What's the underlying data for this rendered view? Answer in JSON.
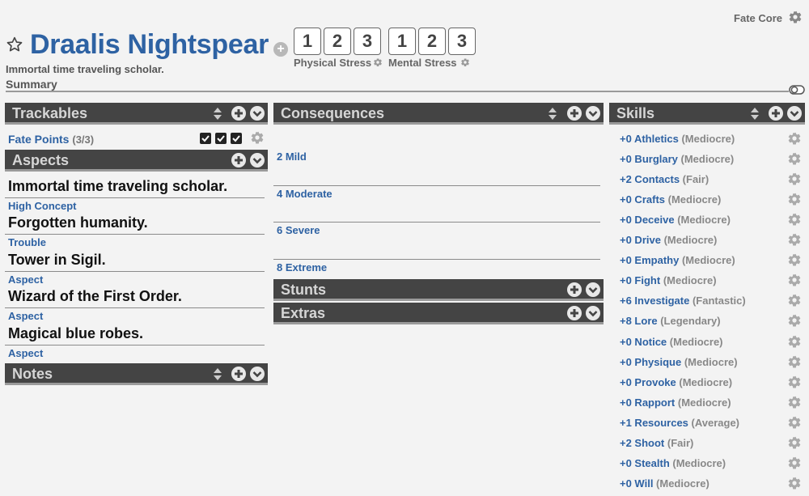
{
  "system": {
    "label": "Fate Core",
    "gear_icon": "gear-icon"
  },
  "character": {
    "name": "Draalis Nightspear",
    "tagline": "Immortal time traveling scholar.",
    "summary_label": "Summary",
    "star_icon": "star-outline-icon"
  },
  "stress": {
    "add_icon": "plus-circle-icon",
    "physical": {
      "label": "Physical Stress",
      "boxes": [
        "1",
        "2",
        "3"
      ]
    },
    "mental": {
      "label": "Mental Stress",
      "boxes": [
        "1",
        "2",
        "3"
      ]
    }
  },
  "trackables": {
    "title": "Trackables",
    "fate_points": {
      "label": "Fate Points",
      "count": "(3/3)",
      "checked": [
        true,
        true,
        true
      ]
    }
  },
  "aspects": {
    "title": "Aspects",
    "items": [
      {
        "text": "Immortal time traveling scholar.",
        "type": "High Concept"
      },
      {
        "text": "Forgotten humanity.",
        "type": "Trouble"
      },
      {
        "text": "Tower in Sigil.",
        "type": "Aspect"
      },
      {
        "text": "Wizard of the First Order.",
        "type": "Aspect"
      },
      {
        "text": "Magical blue robes.",
        "type": "Aspect"
      }
    ]
  },
  "notes": {
    "title": "Notes"
  },
  "consequences": {
    "title": "Consequences",
    "items": [
      {
        "label": "2 Mild"
      },
      {
        "label": "4 Moderate"
      },
      {
        "label": "6 Severe"
      },
      {
        "label": "8 Extreme"
      }
    ]
  },
  "stunts": {
    "title": "Stunts"
  },
  "extras": {
    "title": "Extras"
  },
  "skills": {
    "title": "Skills",
    "items": [
      {
        "bonus": "+0",
        "name": "Athletics",
        "rank": "(Mediocre)"
      },
      {
        "bonus": "+0",
        "name": "Burglary",
        "rank": "(Mediocre)"
      },
      {
        "bonus": "+2",
        "name": "Contacts",
        "rank": "(Fair)"
      },
      {
        "bonus": "+0",
        "name": "Crafts",
        "rank": "(Mediocre)"
      },
      {
        "bonus": "+0",
        "name": "Deceive",
        "rank": "(Mediocre)"
      },
      {
        "bonus": "+0",
        "name": "Drive",
        "rank": "(Mediocre)"
      },
      {
        "bonus": "+0",
        "name": "Empathy",
        "rank": "(Mediocre)"
      },
      {
        "bonus": "+0",
        "name": "Fight",
        "rank": "(Mediocre)"
      },
      {
        "bonus": "+6",
        "name": "Investigate",
        "rank": "(Fantastic)"
      },
      {
        "bonus": "+8",
        "name": "Lore",
        "rank": "(Legendary)"
      },
      {
        "bonus": "+0",
        "name": "Notice",
        "rank": "(Mediocre)"
      },
      {
        "bonus": "+0",
        "name": "Physique",
        "rank": "(Mediocre)"
      },
      {
        "bonus": "+0",
        "name": "Provoke",
        "rank": "(Mediocre)"
      },
      {
        "bonus": "+0",
        "name": "Rapport",
        "rank": "(Mediocre)"
      },
      {
        "bonus": "+1",
        "name": "Resources",
        "rank": "(Average)"
      },
      {
        "bonus": "+2",
        "name": "Shoot",
        "rank": "(Fair)"
      },
      {
        "bonus": "+0",
        "name": "Stealth",
        "rank": "(Mediocre)"
      },
      {
        "bonus": "+0",
        "name": "Will",
        "rank": "(Mediocre)"
      }
    ]
  },
  "colors": {
    "accent": "#2e62a3",
    "panel_header": "#444444",
    "background": "#f3f3f3"
  }
}
